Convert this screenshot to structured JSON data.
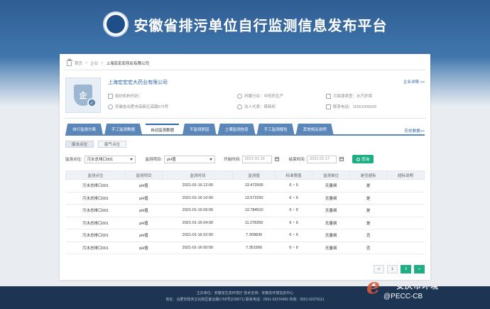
{
  "header": {
    "title": "安徽省排污单位自行监测信息发布平台"
  },
  "breadcrumb": {
    "home": "首页",
    "level1": "企业",
    "current": "上海宏宏宏药业有限公司"
  },
  "company": {
    "name": "上海宏宏宏大药业有限公司",
    "link": "企业详情 >>",
    "org_code": "组织机构代码：",
    "industry": "所属行业：中药药生产",
    "pollution_type": "污染源类型：水汽环境",
    "address": "安徽省合肥市高新区高路575号",
    "legal_rep": "法人代表：蒋新权",
    "phone": "联系电话：15551000626"
  },
  "tabs": [
    "自行监测方案",
    "手工监测数据",
    "自动监测数据",
    "不监测原因",
    "土壤监测信息",
    "手工监测报告",
    "其他相关说明"
  ],
  "active_tab_index": 2,
  "history_link": "历史数据>>",
  "subtabs": [
    "废水点位",
    "废气点位"
  ],
  "filters": {
    "point_label": "监测点位:",
    "point_value": "污水总排口001",
    "item_label": "监测项目:",
    "item_value": "pH值",
    "start_label": "开始时间:",
    "start_value": "2021-01-16",
    "end_label": "结束时间:",
    "end_value": "2021-01-17",
    "query_label": "查询"
  },
  "table": {
    "headers": [
      "监测点位",
      "监测项目",
      "监测时间",
      "监测值",
      "标准限值",
      "监测单位",
      "是否超标",
      "超标说明"
    ],
    "rows": [
      [
        "污水总排口001",
        "pH值",
        "2021-01-16 12:00",
        "13.472500",
        "6 ~ 9",
        "无量纲",
        "是",
        ""
      ],
      [
        "污水总排口001",
        "pH值",
        "2021-01-16 10:00",
        "13.572250",
        "6 ~ 9",
        "无量纲",
        "是",
        ""
      ],
      [
        "污水总排口001",
        "pH值",
        "2021-01-16 06:00",
        "13.784910",
        "6 ~ 9",
        "无量纲",
        "是",
        ""
      ],
      [
        "污水总排口001",
        "pH值",
        "2021-01-16 04:00",
        "11.278250",
        "6 ~ 9",
        "无量纲",
        "是",
        ""
      ],
      [
        "污水总排口001",
        "pH值",
        "2021-01-16 02:00",
        "7.309830",
        "6 ~ 9",
        "无量纲",
        "否",
        ""
      ],
      [
        "污水总排口001",
        "pH值",
        "2021-01-16 00:00",
        "7.351560",
        "6 ~ 9",
        "无量纲",
        "否",
        ""
      ]
    ]
  },
  "pagination": {
    "prev": "«",
    "pages": [
      "1",
      "2"
    ],
    "active": "2",
    "next": "»"
  },
  "footer": {
    "line1": "主办单位：安徽省生态环境厅 技术支持：安徽省环境信息中心",
    "line2": "地址：合肥市政务文化新区紫云路1766号(230071) 联系电话：0551-62376405 传真：0551-62376111"
  },
  "watermark": {
    "name": "安庆市环境",
    "handle": "@PECC-CB"
  }
}
